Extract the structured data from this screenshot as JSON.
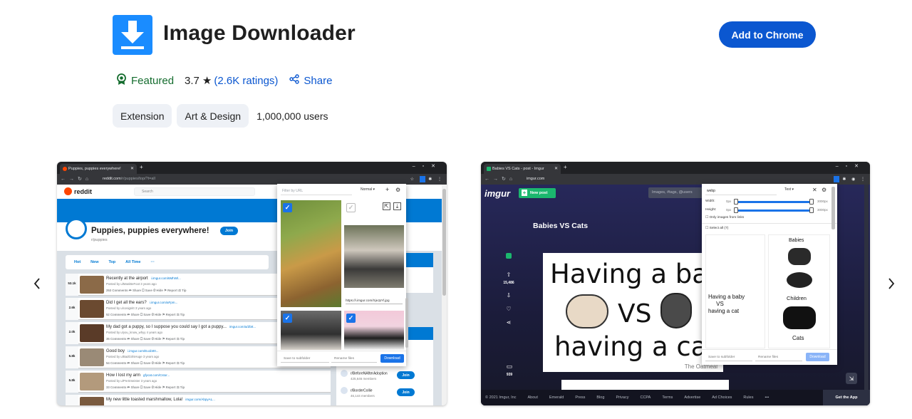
{
  "app": {
    "title": "Image Downloader",
    "add_button": "Add to Chrome"
  },
  "meta": {
    "featured_label": "Featured",
    "rating": "3.7",
    "ratings_count": "2.6K ratings",
    "share_label": "Share"
  },
  "chips": [
    "Extension",
    "Art & Design"
  ],
  "users": "1,000,000 users",
  "colors": {
    "accent": "#0b57d0",
    "featured": "#146c2e",
    "icon_bg": "#1a8cff"
  },
  "screenshot1": {
    "tab_title": "Puppies, puppies everywhere!",
    "url_host": "reddit.com",
    "url_path": "/r/puppies/top/?t=all",
    "reddit_logo": "reddit",
    "search_placeholder": "Search",
    "subreddit_title": "Puppies, puppies everywhere!",
    "subreddit_name": "r/puppies",
    "join_label": "Join",
    "sort": [
      "Hot",
      "New",
      "Top",
      "All Time",
      "···"
    ],
    "posts": [
      {
        "votes": "53.1k",
        "title": "Recently at the airport",
        "domain": "i.imgur.com/6MhWl...",
        "meta": "Posted by u/ManiBeFoot 3 years ago",
        "comments": "253 Comments"
      },
      {
        "votes": "2.6k",
        "title": "Did I get all the ears?",
        "domain": "i.imgur.com/aFpm...",
        "meta": "Posted by u/cosignitt 3 years ago",
        "comments": "52 Comments"
      },
      {
        "votes": "2.0k",
        "title": "My dad got a puppy, so I suppose you could say I got a puppy...",
        "domain": "imgur.com/a/ZbIt...",
        "meta": "Posted by u/you_know_whyy 4 years ago",
        "comments": "35 Comments"
      },
      {
        "votes": "5.8k",
        "title": "Good boy",
        "domain": "i.imgur.com/Eu1b00...",
        "meta": "Posted by u/BadGirlsHuge 3 years ago",
        "comments": "54 Comments"
      },
      {
        "votes": "5.8k",
        "title": "How I lost my arm",
        "domain": "gfycat.com/Cstor...",
        "meta": "Posted by u/PreSmeister 3 years ago",
        "comments": "33 Comments"
      },
      {
        "votes": "",
        "title": "My new little toasted marshmallow, Lola!",
        "domain": "imgur.com/AbpyAL...",
        "meta": "",
        "comments": ""
      }
    ],
    "post_actions": [
      "Share",
      "Save",
      "Hide",
      "Report",
      "Tip"
    ],
    "communities": [
      {
        "name": "",
        "members": "35,600 members"
      },
      {
        "name": "r/BeforeNAfterAdoption",
        "members": "425,646 members"
      },
      {
        "name": "r/BorderCollie",
        "members": "46,144 members"
      }
    ],
    "popup": {
      "filter_placeholder": "Filter by URL",
      "mode": "Normal",
      "image_url": "https://i.imgur.com/XjeJpYl.jpg",
      "subfolder_placeholder": "Save to subfolder",
      "rename_placeholder": "Rename files",
      "download_label": "Download"
    }
  },
  "screenshot2": {
    "tab_title": "Babies VS Cats - post - Imgur",
    "url_host": "imgur.com",
    "logo": "imgur",
    "new_post": "New post",
    "search_placeholder": "Images, #tags, @users",
    "post_title": "Babies VS Cats",
    "votes": "15,486",
    "comments_count": "939",
    "comic_line1": "Having a baby",
    "comic_vs": "VS",
    "comic_line2": "having a cat",
    "comic_signature": "The Oatmeal",
    "footer_links": [
      "© 2021 Imgur, Inc",
      "About",
      "Emerald",
      "Press",
      "Blog",
      "Privacy",
      "CCPA",
      "Terms",
      "Advertise",
      "Ad Choices",
      "Rules",
      "•••"
    ],
    "get_app": "Get the App",
    "popup": {
      "filter_value": "webp",
      "mode": "Text",
      "width_label": "Width:",
      "height_label": "Height:",
      "min_px": "0px",
      "max_px": "3000px",
      "only_links": "Only images from links",
      "select_all": "Select all (7)",
      "thumb_texts": [
        "Babies",
        "Children",
        "Cats"
      ],
      "subfolder_placeholder": "Save to subfolder",
      "rename_placeholder": "Rename files",
      "download_label": "Download"
    }
  }
}
